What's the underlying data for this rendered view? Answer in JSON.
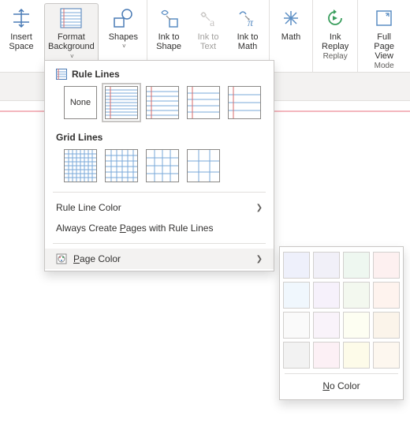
{
  "ribbon": {
    "insert_space": {
      "l1": "Insert",
      "l2": "Space"
    },
    "format_bg": {
      "l1": "Format",
      "l2": "Background"
    },
    "shapes_label": "Shapes",
    "ink_shape": {
      "l1": "Ink to",
      "l2": "Shape"
    },
    "ink_text": {
      "l1": "Ink to",
      "l2": "Text"
    },
    "ink_math": {
      "l1": "Ink to",
      "l2": "Math"
    },
    "math_label": "Math",
    "ink_replay": {
      "l1": "Ink",
      "l2": "Replay"
    },
    "full_page": {
      "l1": "Full Page",
      "l2": "View"
    },
    "group_replay": "Replay",
    "group_mode": "Mode"
  },
  "dropdown": {
    "rule_lines_heading": "Rule Lines",
    "grid_lines_heading": "Grid Lines",
    "none_label": "None",
    "rule_line_color": "Rule Line Color",
    "always_create": "Always Create Pages with Rule Lines",
    "always_create_key": "P",
    "page_color": "Page Color",
    "page_color_key": "P"
  },
  "rule_swatches": [
    {
      "id": "none"
    },
    {
      "id": "narrow",
      "spacing": 4,
      "margin": true
    },
    {
      "id": "college",
      "spacing": 6,
      "margin": true
    },
    {
      "id": "standard",
      "spacing": 8,
      "margin": true
    },
    {
      "id": "wide",
      "spacing": 10,
      "margin": true
    }
  ],
  "grid_swatches": [
    {
      "id": "small",
      "size": 5
    },
    {
      "id": "medium",
      "size": 7
    },
    {
      "id": "large",
      "size": 10
    },
    {
      "id": "vlarge",
      "size": 14
    }
  ],
  "page_colors": [
    "#eef0fb",
    "#f1f0f8",
    "#eef7f0",
    "#fdf0f0",
    "#f0f7fd",
    "#f6f1fb",
    "#f3f8ef",
    "#fef3ee",
    "#fafafa",
    "#f9f3fa",
    "#fdfef2",
    "#fbf4ea",
    "#f2f2f2",
    "#fcf0f5",
    "#fdfbe9",
    "#fdf7ef"
  ],
  "flyout": {
    "no_color": "No Color",
    "no_color_key": "N"
  }
}
